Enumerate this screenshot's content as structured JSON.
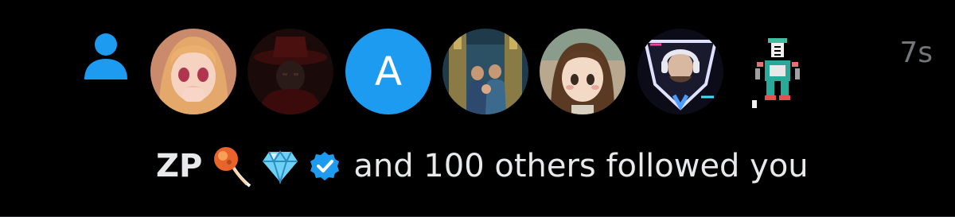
{
  "notification": {
    "type_icon": "person-icon",
    "timestamp": "7s",
    "user_name": "ZP",
    "badges": [
      "fire-comet-emoji",
      "gem-emoji",
      "verified-badge-icon"
    ],
    "message": "and 100 others followed you",
    "avatars": [
      {
        "name": "anime-girl-blonde-avatar"
      },
      {
        "name": "dark-hat-figure-avatar"
      },
      {
        "name": "letter-avatar",
        "letter": "A"
      },
      {
        "name": "family-cathedral-avatar"
      },
      {
        "name": "anime-girl-brown-hair-avatar"
      },
      {
        "name": "gamer-headphones-avatar"
      },
      {
        "name": "pixel-robot-avatar"
      }
    ]
  },
  "colors": {
    "background": "#000000",
    "text_primary": "#e7e9ea",
    "text_secondary": "#71767b",
    "accent_blue": "#1d9bf0",
    "divider": "#2f3336"
  }
}
